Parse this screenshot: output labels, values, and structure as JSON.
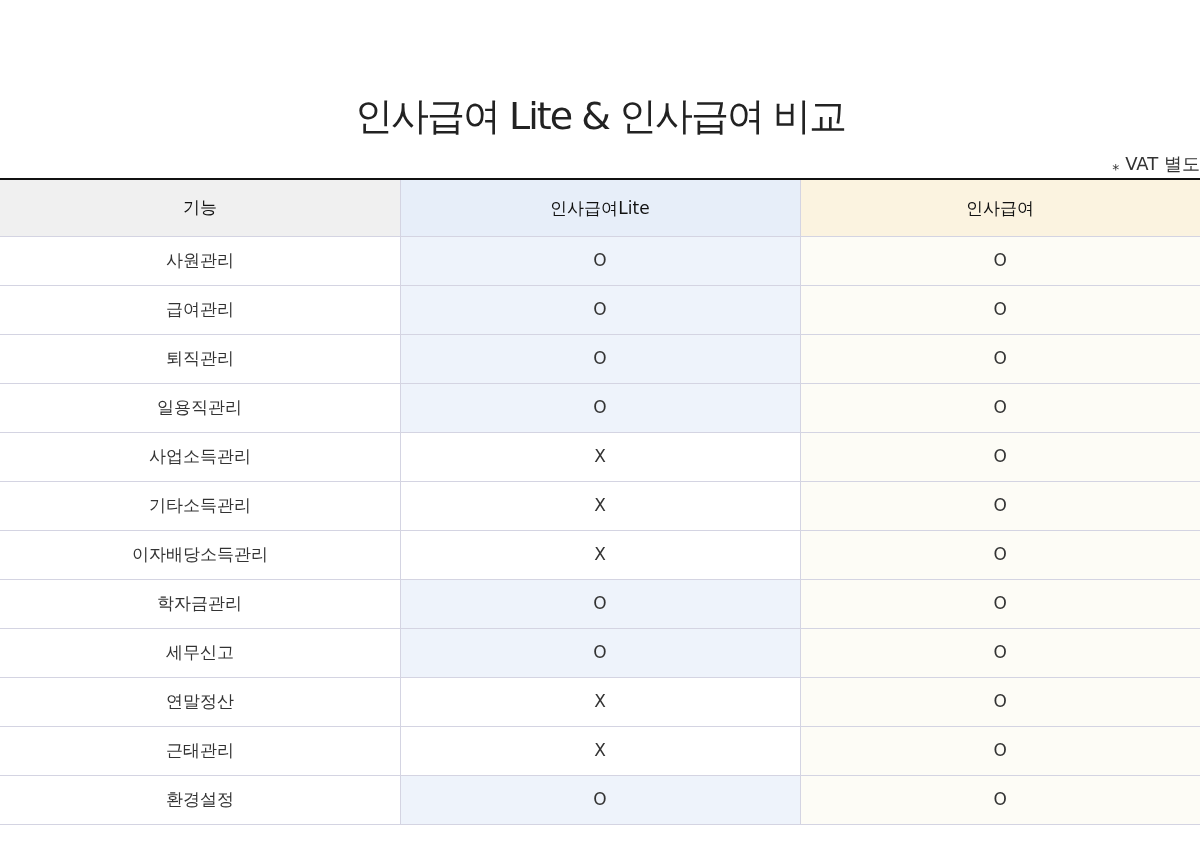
{
  "title": "인사급여 Lite & 인사급여 비교",
  "note": {
    "mark": "*",
    "text": "VAT 별도"
  },
  "table": {
    "columns": [
      "기능",
      "인사급여Lite",
      "인사급여"
    ],
    "rows": [
      {
        "feature": "사원관리",
        "lite": {
          "text": "O",
          "supported": true
        },
        "full": {
          "text": "O"
        }
      },
      {
        "feature": "급여관리",
        "lite": {
          "text": "O",
          "supported": true
        },
        "full": {
          "text": "O"
        }
      },
      {
        "feature": "퇴직관리",
        "lite": {
          "text": "O",
          "supported": true
        },
        "full": {
          "text": "O"
        }
      },
      {
        "feature": "일용직관리",
        "lite": {
          "text": "O",
          "supported": true
        },
        "full": {
          "text": "O"
        }
      },
      {
        "feature": "사업소득관리",
        "lite": {
          "text": "X",
          "supported": false
        },
        "full": {
          "text": "O"
        }
      },
      {
        "feature": "기타소득관리",
        "lite": {
          "text": "X",
          "supported": false
        },
        "full": {
          "text": "O"
        }
      },
      {
        "feature": "이자배당소득관리",
        "lite": {
          "text": "X",
          "supported": false
        },
        "full": {
          "text": "O"
        }
      },
      {
        "feature": "학자금관리",
        "lite": {
          "text": "O",
          "supported": true
        },
        "full": {
          "text": "O"
        }
      },
      {
        "feature": "세무신고",
        "lite": {
          "text": "O",
          "supported": true
        },
        "full": {
          "text": "O"
        }
      },
      {
        "feature": "연말정산",
        "lite": {
          "text": "X",
          "supported": false
        },
        "full": {
          "text": "O"
        }
      },
      {
        "feature": "근태관리",
        "lite": {
          "text": "X",
          "supported": false
        },
        "full": {
          "text": "O"
        }
      },
      {
        "feature": "환경설정",
        "lite": {
          "text": "O",
          "supported": true
        },
        "full": {
          "text": "O"
        }
      }
    ]
  }
}
